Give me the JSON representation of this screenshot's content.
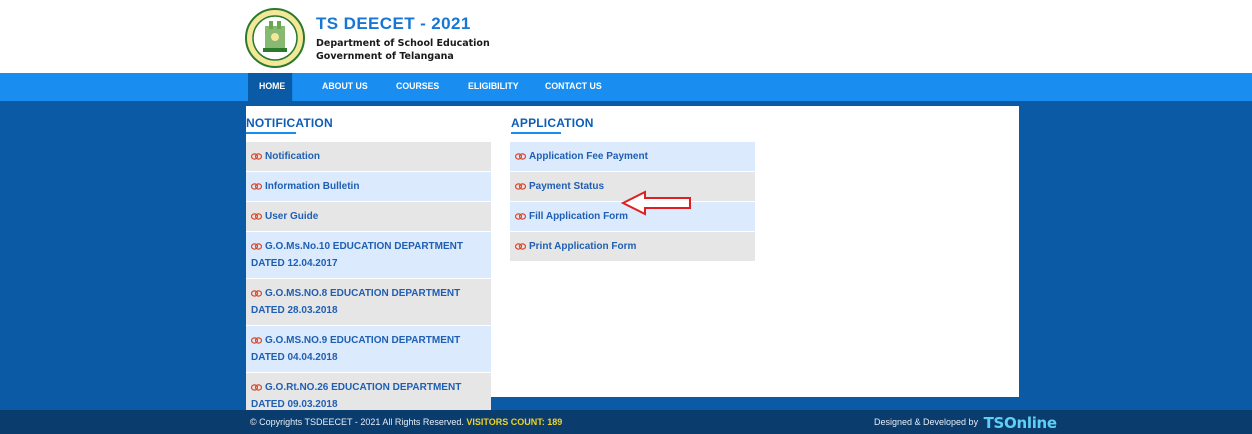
{
  "header": {
    "logo_alt": "Telangana State emblem",
    "title": "TS DEECET - 2021",
    "subtitle1": "Department of School Education",
    "subtitle2": "Government of Telangana"
  },
  "nav": {
    "items": [
      {
        "label": "HOME",
        "active": true
      },
      {
        "label": "ABOUT US",
        "active": false
      },
      {
        "label": "COURSES",
        "active": false
      },
      {
        "label": "ELIGIBILITY",
        "active": false
      },
      {
        "label": "CONTACT US",
        "active": false
      }
    ]
  },
  "notification": {
    "heading": "NOTIFICATION",
    "items": [
      "Notification",
      "Information Bulletin",
      "User Guide",
      "G.O.Ms.No.10 EDUCATION DEPARTMENT DATED 12.04.2017",
      "G.O.MS.NO.8 EDUCATION DEPARTMENT DATED 28.03.2018",
      "G.O.MS.NO.9 EDUCATION DEPARTMENT DATED 04.04.2018",
      "G.O.Rt.NO.26 EDUCATION DEPARTMENT DATED 09.03.2018"
    ]
  },
  "application": {
    "heading": "APPLICATION",
    "items": [
      "Application Fee Payment",
      "Payment Status",
      "Fill Application Form",
      "Print Application Form"
    ]
  },
  "footer": {
    "copyright": "© Copyrights TSDEECET - 2021 All Rights Reserved.",
    "visitors": "VISITORS COUNT: 189",
    "designed_by": "Designed & Developed by",
    "brand": "TSOnline"
  },
  "colors": {
    "nav_blue": "#1a8df0",
    "dark_blue": "#0b5aa6",
    "footer_blue": "#0a3c6e",
    "link_blue": "#1f5fb3",
    "visitor_yellow": "#f2d41e",
    "annotation_red": "#e02020"
  },
  "icons": {
    "link": "chain-link-icon",
    "annotation": "red-arrow-icon"
  }
}
